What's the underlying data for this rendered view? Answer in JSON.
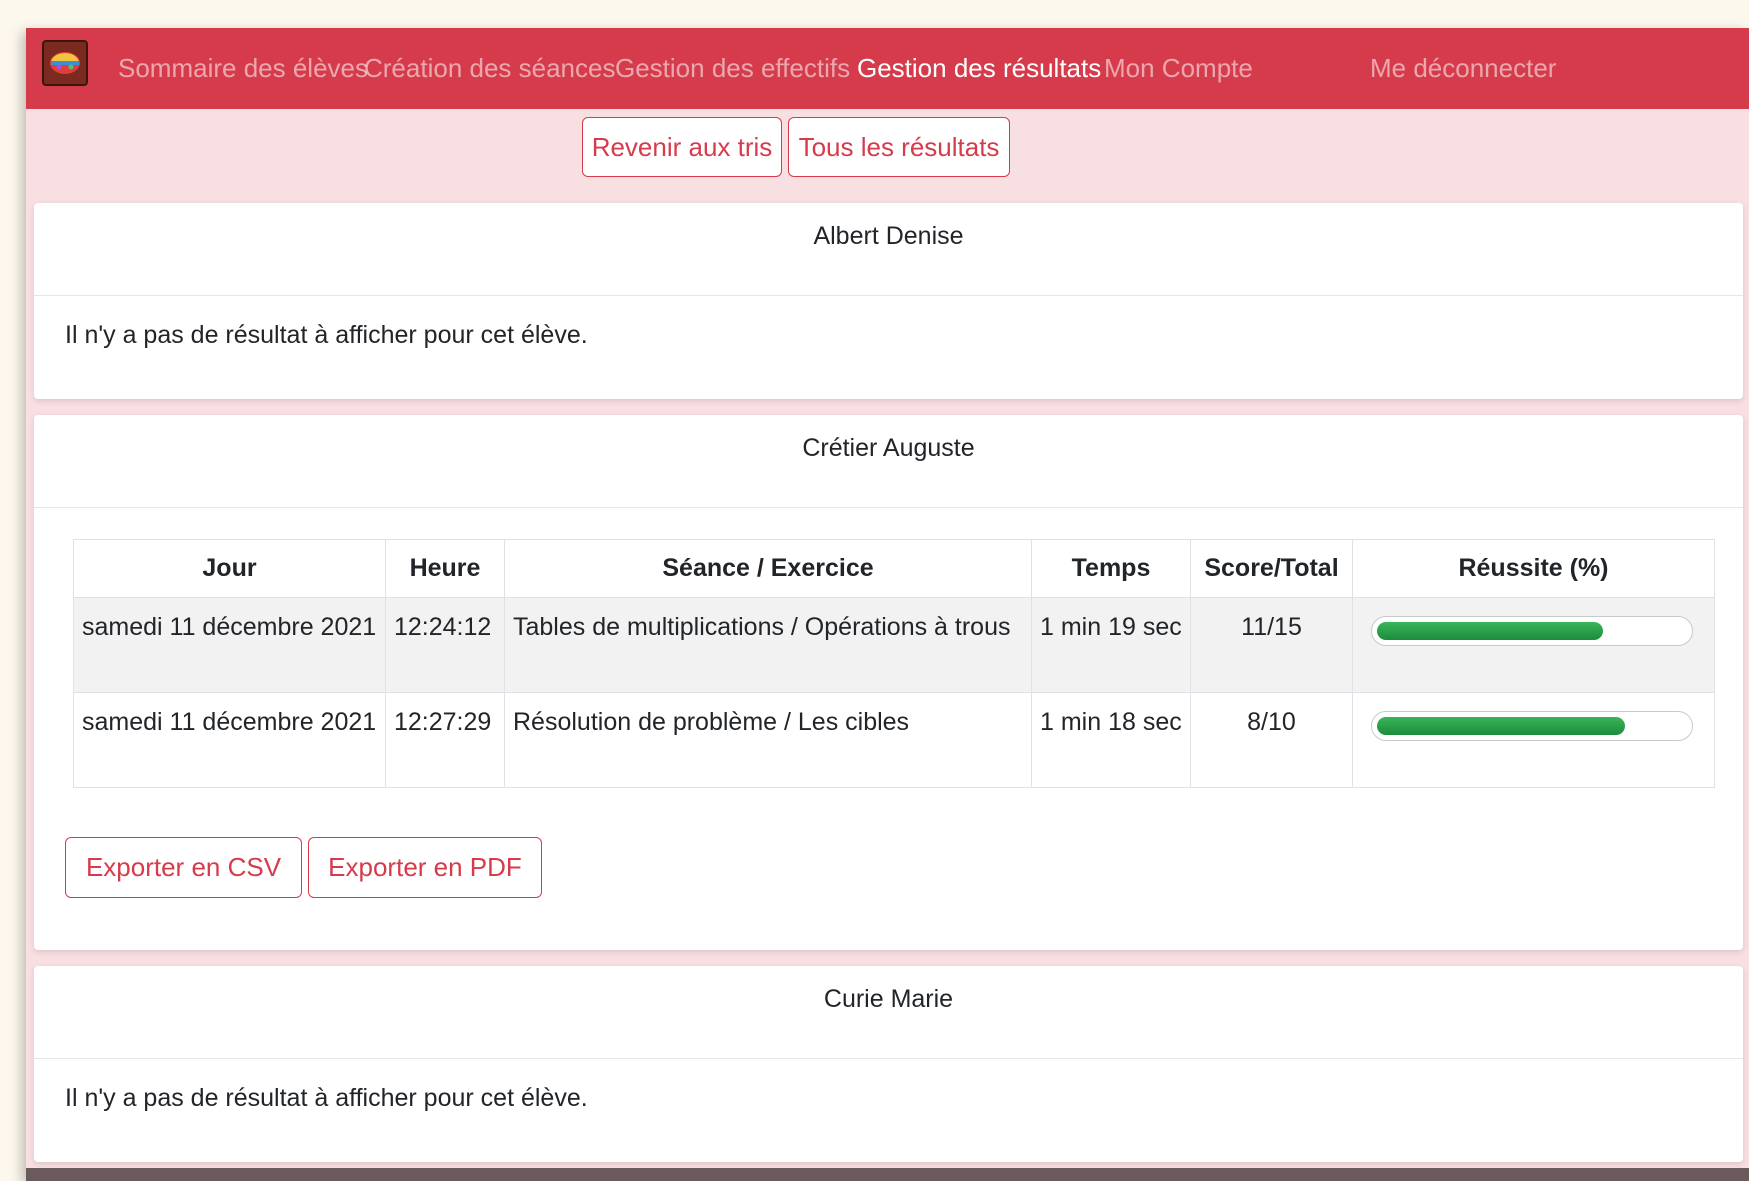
{
  "nav": {
    "logo": "app-logo",
    "links": [
      {
        "label": "Sommaire des élèves",
        "active": false
      },
      {
        "label": "Création des séances",
        "active": false
      },
      {
        "label": "Gestion des effectifs",
        "active": false
      },
      {
        "label": "Gestion des résultats",
        "active": true
      },
      {
        "label": "Mon Compte",
        "active": false
      }
    ],
    "logout_label": "Me déconnecter"
  },
  "toolbar": {
    "back_label": "Revenir aux tris",
    "all_results_label": "Tous les résultats"
  },
  "students": [
    {
      "name": "Albert Denise",
      "empty_message": "Il n'y a pas de résultat à afficher pour cet élève."
    },
    {
      "name": "Crétier Auguste",
      "table": {
        "headers": [
          "Jour",
          "Heure",
          "Séance / Exercice",
          "Temps",
          "Score/Total",
          "Réussite (%)"
        ],
        "rows": [
          {
            "jour": "samedi 11 décembre 2021",
            "heure": "12:24:12",
            "seance": "Tables de multiplications / Opérations à trous",
            "temps": "1 min 19 sec",
            "score": "11/15",
            "reussite": 73
          },
          {
            "jour": "samedi 11 décembre 2021",
            "heure": "12:27:29",
            "seance": "Résolution de problème / Les cibles",
            "temps": "1 min 18 sec",
            "score": "8/10",
            "reussite": 80
          }
        ]
      },
      "export_csv_label": "Exporter en CSV",
      "export_pdf_label": "Exporter en PDF"
    },
    {
      "name": "Curie Marie",
      "empty_message": "Il n'y a pas de résultat à afficher pour cet élève."
    }
  ],
  "colors": {
    "brand": "#d63b4c",
    "success": "#28a745"
  }
}
